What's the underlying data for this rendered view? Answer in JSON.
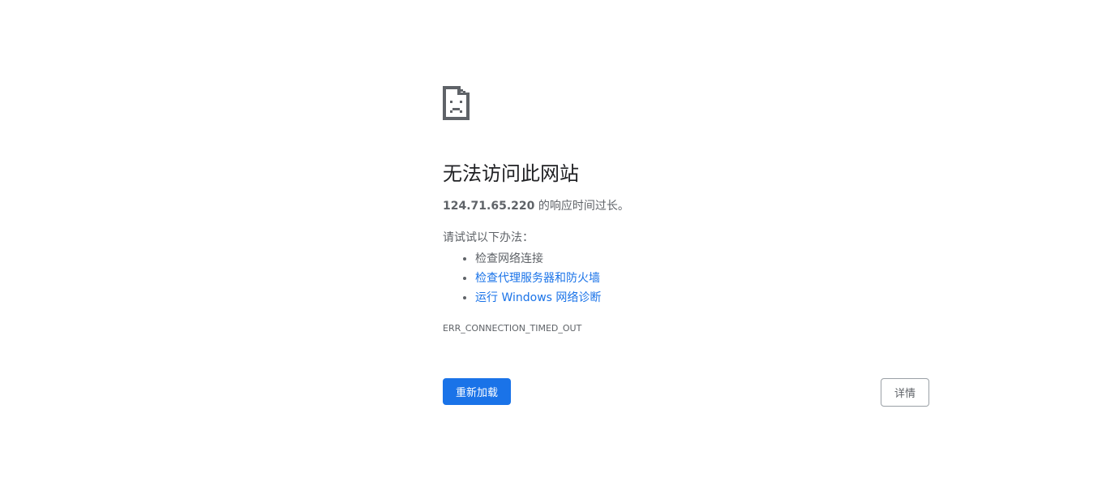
{
  "error_page": {
    "icon": "sad-page-icon",
    "title": "无法访问此网站",
    "host": "124.71.65.220",
    "host_suffix": " 的响应时间过长。",
    "try_label": "请试试以下办法：",
    "suggestions": [
      {
        "label": "检查网络连接",
        "is_link": false
      },
      {
        "label": "检查代理服务器和防火墙",
        "is_link": true
      },
      {
        "label": "运行 Windows 网络诊断",
        "is_link": true
      }
    ],
    "error_code": "ERR_CONNECTION_TIMED_OUT"
  },
  "buttons": {
    "reload_label": "重新加载",
    "details_label": "详情"
  },
  "colors": {
    "primary_blue": "#1a73e8",
    "text_secondary": "#5f6368",
    "text_primary": "#202124",
    "icon_gray": "#5f6368"
  }
}
